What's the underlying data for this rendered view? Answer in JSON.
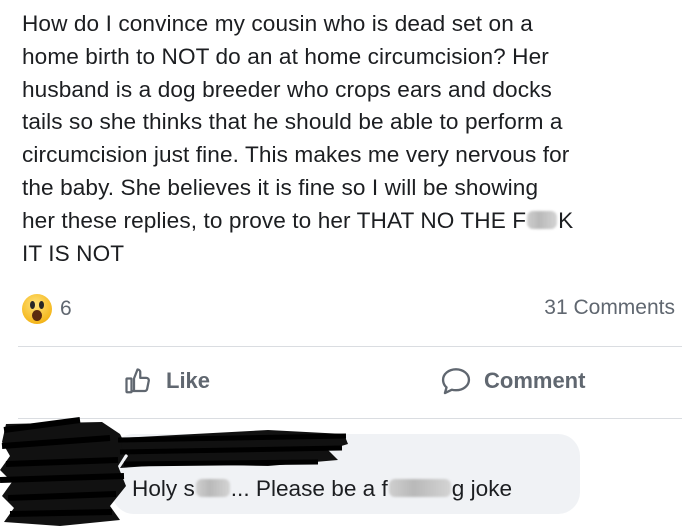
{
  "post": {
    "lines": [
      "How do I convince my cousin who is dead set on a",
      "home birth to NOT do an at home circumcision? Her",
      "husband is a dog breeder who crops ears and docks",
      "tails so she thinks that he should be able to perform a",
      "circumcision just fine. This makes me very nervous for",
      "the baby. She believes it is fine so I will be showing",
      "her these replies, to prove to her THAT NO THE F",
      "IT IS NOT"
    ],
    "line7_end": "K"
  },
  "reactions": {
    "icon": "wow-reaction-icon",
    "count": "6"
  },
  "comments_count": "31 Comments",
  "actions": {
    "like_label": "Like",
    "comment_label": "Comment"
  },
  "comment": {
    "text_part1": "Holy s",
    "text_part2": "... Please be a f",
    "text_part3": "g joke"
  },
  "colors": {
    "text": "#1c1e21",
    "secondary": "#606770",
    "bubble": "#f0f2f5",
    "divider": "#dadde1"
  }
}
